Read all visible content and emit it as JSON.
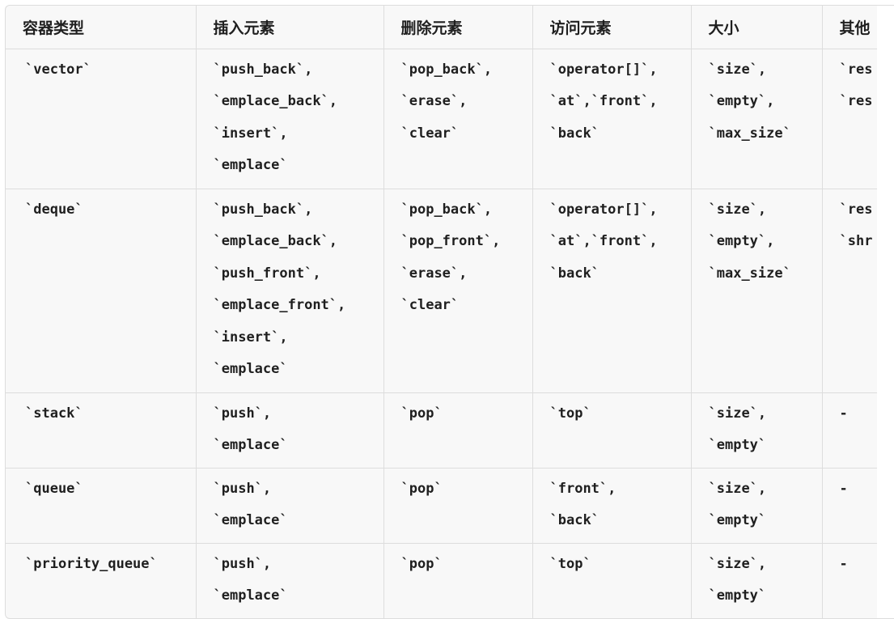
{
  "table": {
    "headers": [
      "容器类型",
      "插入元素",
      "删除元素",
      "访问元素",
      "大小",
      "其他"
    ],
    "rows": [
      {
        "container": "`vector`",
        "insert": [
          "`push_back`,",
          "`emplace_back`,",
          "`insert`,",
          "`emplace`"
        ],
        "remove": [
          "`pop_back`,",
          "`erase`,",
          "`clear`"
        ],
        "access": [
          "`operator[]`,",
          "`at`,`front`,",
          "`back`"
        ],
        "size": [
          "`size`,",
          "`empty`,",
          "`max_size`"
        ],
        "other": [
          "`res",
          "`res"
        ]
      },
      {
        "container": "`deque`",
        "insert": [
          "`push_back`,",
          "`emplace_back`,",
          "`push_front`,",
          "`emplace_front`,",
          "`insert`,",
          "`emplace`"
        ],
        "remove": [
          "`pop_back`,",
          "`pop_front`,",
          "`erase`,",
          "`clear`"
        ],
        "access": [
          "`operator[]`,",
          "`at`,`front`,",
          "`back`"
        ],
        "size": [
          "`size`,",
          "`empty`,",
          "`max_size`"
        ],
        "other": [
          "`res",
          "`shr"
        ]
      },
      {
        "container": "`stack`",
        "insert": [
          "`push`,",
          "`emplace`"
        ],
        "remove": [
          "`pop`"
        ],
        "access": [
          "`top`"
        ],
        "size": [
          "`size`,",
          "`empty`"
        ],
        "other": [
          "-"
        ]
      },
      {
        "container": "`queue`",
        "insert": [
          "`push`,",
          "`emplace`"
        ],
        "remove": [
          "`pop`"
        ],
        "access": [
          "`front`,",
          "`back`"
        ],
        "size": [
          "`size`,",
          "`empty`"
        ],
        "other": [
          "-"
        ]
      },
      {
        "container": "`priority_queue`",
        "insert": [
          "`push`,",
          "`emplace`"
        ],
        "remove": [
          "`pop`"
        ],
        "access": [
          "`top`"
        ],
        "size": [
          "`size`,",
          "`empty`"
        ],
        "other": [
          "-"
        ]
      }
    ]
  },
  "colors": {
    "table_background": "#f8f8f8",
    "border": "#dddddd",
    "text": "#1f1f1f",
    "page_background": "#ffffff"
  }
}
